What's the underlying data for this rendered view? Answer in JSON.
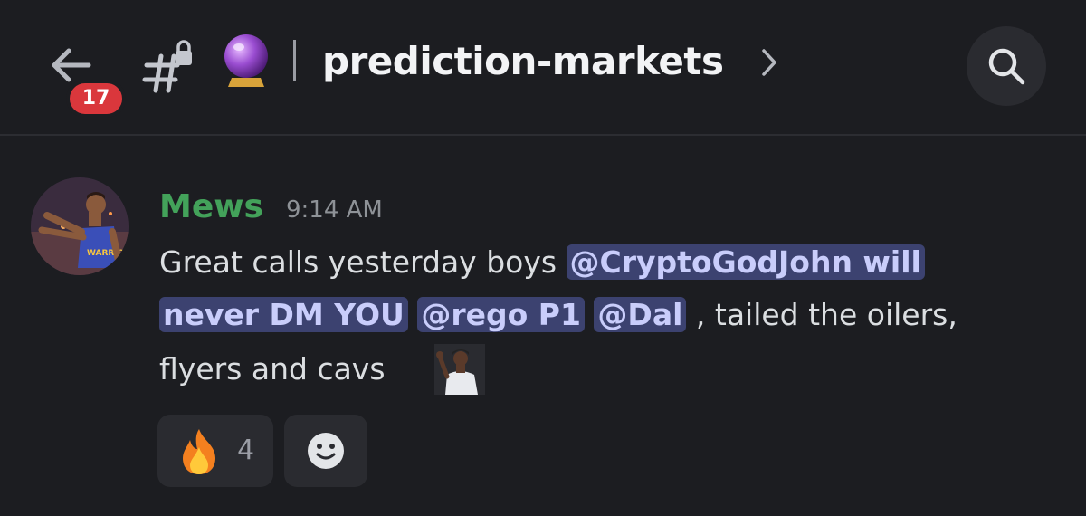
{
  "header": {
    "unread_count": "17",
    "channel_name": "prediction-markets"
  },
  "message": {
    "author": "Mews",
    "author_color": "#43a25a",
    "timestamp": "9:14 AM",
    "line1_text": "Great calls yesterday boys ",
    "mention1_part1": "@CryptoGodJohn will",
    "mention1_part2": "never DM YOU",
    "mention2": "@rego P1",
    "mention3": "@Dal",
    "line2_text": " , tailed the oilers,",
    "line3_text": "flyers and cavs "
  },
  "reactions": [
    {
      "icon": "fire-icon",
      "count": "4"
    }
  ],
  "colors": {
    "background": "#1c1d21",
    "mention_bg": "#3c4270",
    "badge": "#da373c"
  }
}
